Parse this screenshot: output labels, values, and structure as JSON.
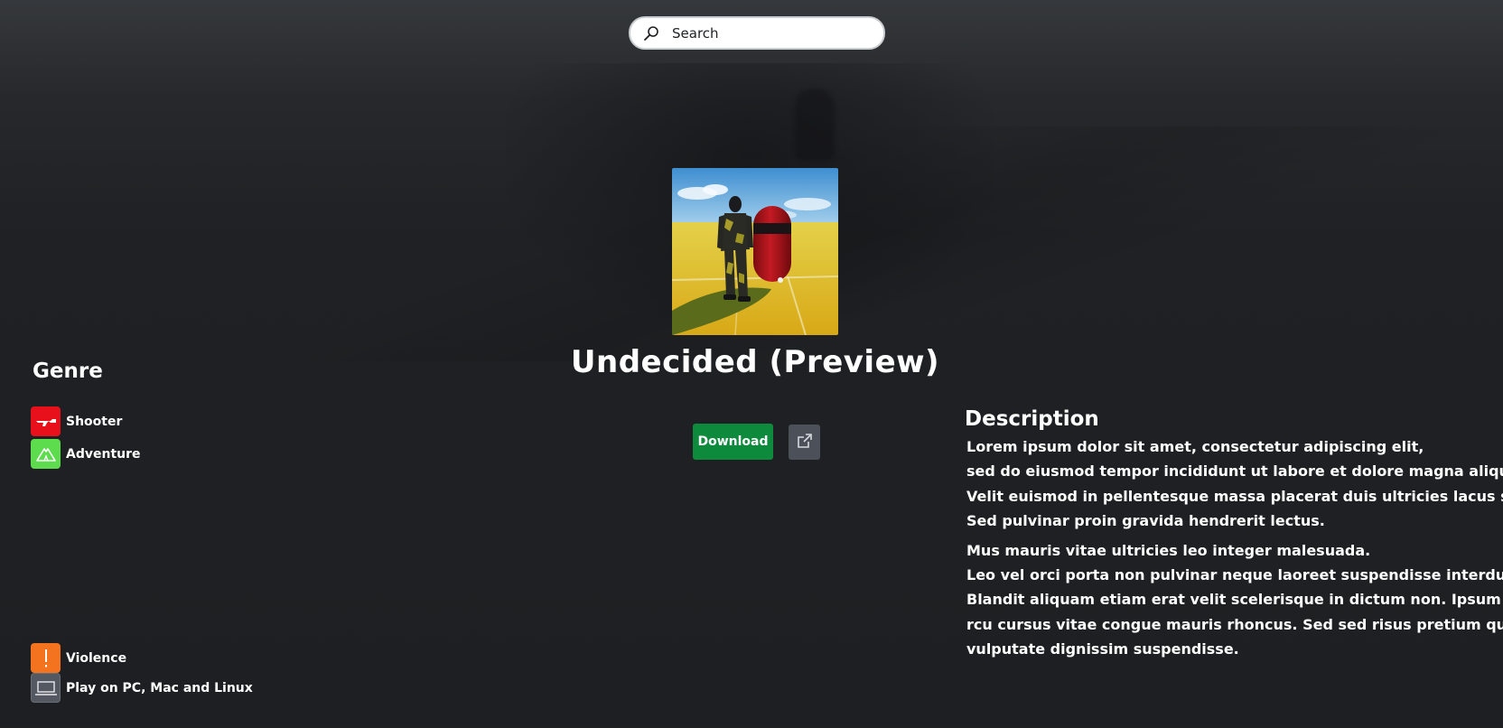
{
  "search": {
    "placeholder": "Search",
    "icon": "search-icon"
  },
  "game": {
    "title": "Undecided (Preview)",
    "cover_alt": "Game cover: armored soldier walking beside a red capsule robot on a yellow field under blue sky"
  },
  "actions": {
    "download_label": "Download",
    "download_color": "#0d8a3c",
    "external_icon": "external-link-icon"
  },
  "genre": {
    "heading": "Genre",
    "items": [
      {
        "label": "Shooter",
        "icon": "shooter-icon",
        "color": "#e8101a"
      },
      {
        "label": "Adventure",
        "icon": "adventure-icon",
        "color": "#5ddc4e"
      }
    ]
  },
  "ratings": {
    "items": [
      {
        "label": "Violence",
        "icon": "warning-icon",
        "color": "#f4731f"
      },
      {
        "label": "Play on PC, Mac and Linux",
        "icon": "laptop-icon",
        "color": "#545860"
      }
    ]
  },
  "description": {
    "heading": "Description",
    "paragraph1": [
      "Lorem ipsum dolor sit amet, consectetur adipiscing elit,",
      "sed do eiusmod tempor incididunt ut labore et dolore magna aliqua.",
      "Velit euismod in pellentesque massa placerat duis ultricies lacus sed.",
      "Sed pulvinar proin gravida hendrerit lectus."
    ],
    "paragraph2": [
      "Mus mauris vitae ultricies leo integer malesuada.",
      "Leo vel orci porta non pulvinar neque laoreet suspendisse interdum.",
      "Blandit aliquam etiam erat velit scelerisque in dictum non. Ipsum a a",
      "rcu cursus vitae congue mauris rhoncus. Sed sed risus pretium quam",
      "vulputate dignissim suspendisse."
    ]
  }
}
